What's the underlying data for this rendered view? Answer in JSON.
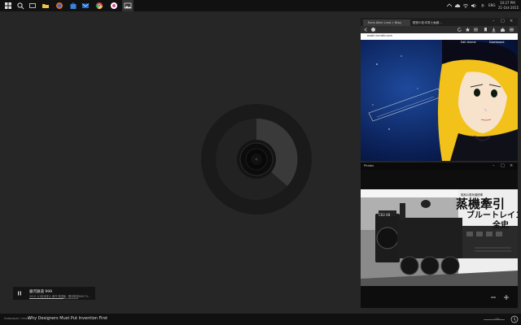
{
  "taskbar": {
    "icons": [
      "start-icon",
      "search-icon",
      "task-view-icon",
      "folder-icon",
      "firefox-icon",
      "store-icon",
      "mail-icon",
      "chrome-icon",
      "itunes-icon",
      "photos-icon"
    ],
    "ime": "あ",
    "language": "ENG",
    "time": "10:27 PM",
    "date": "21-Oct-2015"
  },
  "now_playing": {
    "title": "銀河鉄道 999",
    "subtitle": "2015 1/1松本零士 原作 電視版 · 銀河鉄道999 TV...",
    "progress": 0.7
  },
  "bottombar": {
    "small": "Instapaper: Unread",
    "title": "Why Designers Must Put Invention First",
    "right": "CPU"
  },
  "browser": {
    "tabs": [
      "Eons Allec Luna » Blog",
      "銀鉄の松本零士画廊..."
    ],
    "url": "esaki.tumblr.com",
    "links": {
      "edit": "Edit theme",
      "dashboard": "Dashboard"
    }
  },
  "photos": {
    "title": "Photos",
    "headline": "蒸機牽引",
    "subheadline": "ブルートレイン",
    "subheadline2": "全史",
    "kicker": "C62 48",
    "caption": "昭和の蒸気機関車"
  },
  "colors": {
    "desktop": "#262626",
    "taskbar": "#111111",
    "ring_dark": "#1a1a1a",
    "ring_light": "#3a3a3a"
  }
}
